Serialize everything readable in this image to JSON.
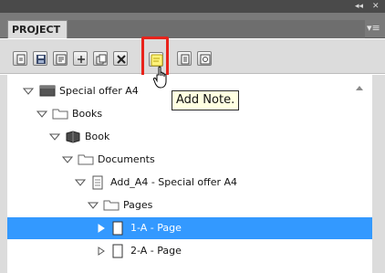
{
  "panel": {
    "window_controls": {
      "collapse": "◂◂",
      "close": "✕"
    },
    "tab": {
      "label": "PROJECT"
    },
    "menu_icon": "panel-menu-icon"
  },
  "toolbar": {
    "buttons": [
      {
        "name": "new-document-icon"
      },
      {
        "name": "save-icon"
      },
      {
        "name": "properties-icon"
      },
      {
        "name": "add-icon"
      },
      {
        "name": "duplicate-icon"
      },
      {
        "name": "delete-icon"
      },
      {
        "name": "add-note-icon"
      },
      {
        "name": "document-view-icon"
      },
      {
        "name": "settings-icon"
      }
    ]
  },
  "tooltip": {
    "text": "Add Note."
  },
  "tree": {
    "rows": [
      {
        "label": "Special offer A4",
        "expanded": true,
        "icon": "project-icon"
      },
      {
        "label": "Books",
        "expanded": true,
        "icon": "folder-icon"
      },
      {
        "label": "Book",
        "expanded": true,
        "icon": "book-icon"
      },
      {
        "label": "Documents",
        "expanded": true,
        "icon": "folder-icon"
      },
      {
        "label": "Add_A4 - Special offer A4",
        "expanded": true,
        "icon": "document-icon"
      },
      {
        "label": "Pages",
        "expanded": true,
        "icon": "folder-icon"
      },
      {
        "label": "1-A - Page",
        "expanded": false,
        "selected": true,
        "icon": "page-icon"
      },
      {
        "label": "2-A - Page",
        "expanded": false,
        "icon": "page-icon"
      }
    ]
  },
  "colors": {
    "selection": "#3399ff",
    "highlight_frame": "#e8231b",
    "tooltip_bg": "#ffffe1"
  }
}
